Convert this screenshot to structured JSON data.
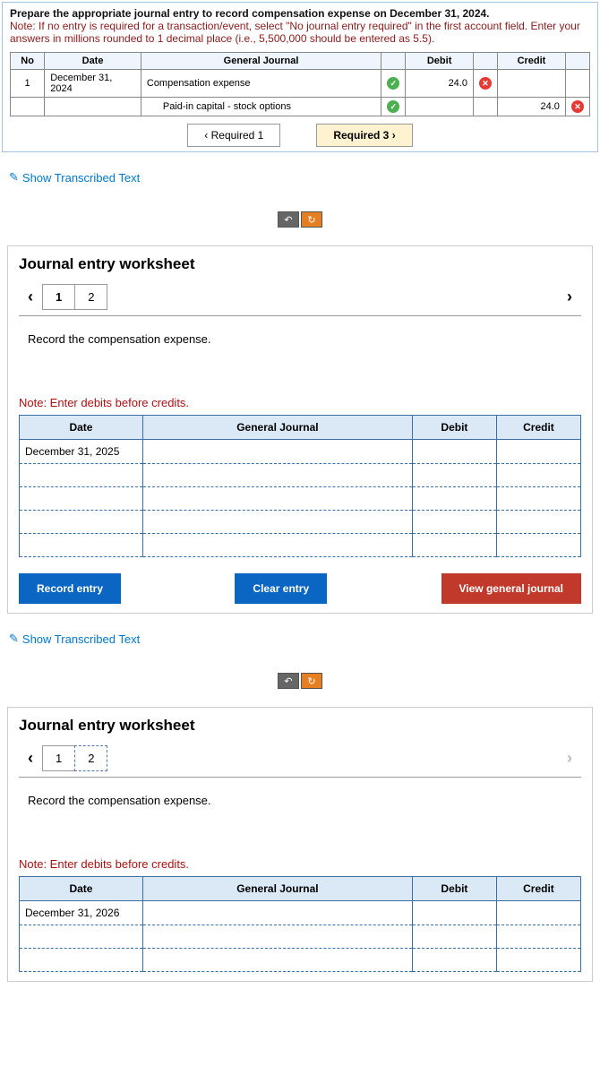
{
  "instruction": {
    "title": "Prepare the appropriate journal entry to record compensation expense on December 31, 2024.",
    "note": "Note: If no entry is required for a transaction/event, select \"No journal entry required\" in the first account field. Enter your answers in millions rounded to 1 decimal place (i.e., 5,500,000 should be entered as 5.5)."
  },
  "top_table": {
    "headers": {
      "no": "No",
      "date": "Date",
      "gj": "General Journal",
      "debit": "Debit",
      "credit": "Credit"
    },
    "rows": [
      {
        "no": "1",
        "date": "December 31, 2024",
        "account": "Compensation expense",
        "debit": "24.0",
        "debit_status": "x",
        "row_status": "check"
      },
      {
        "account": "Paid-in capital - stock options",
        "credit": "24.0",
        "credit_status": "x",
        "row_status": "check"
      }
    ]
  },
  "nav": {
    "prev": "‹  Required 1",
    "next": "Required 3  ›"
  },
  "show_transcribed": "Show Transcribed Text",
  "worksheet1": {
    "title": "Journal entry worksheet",
    "tabs": [
      "1",
      "2"
    ],
    "instruction": "Record the compensation expense.",
    "note": "Note: Enter debits before credits.",
    "headers": {
      "date": "Date",
      "gj": "General Journal",
      "debit": "Debit",
      "credit": "Credit"
    },
    "first_date": "December 31, 2025",
    "buttons": {
      "record": "Record entry",
      "clear": "Clear entry",
      "view": "View general journal"
    }
  },
  "worksheet2": {
    "title": "Journal entry worksheet",
    "tabs": [
      "1",
      "2"
    ],
    "instruction": "Record the compensation expense.",
    "note": "Note: Enter debits before credits.",
    "headers": {
      "date": "Date",
      "gj": "General Journal",
      "debit": "Debit",
      "credit": "Credit"
    },
    "first_date": "December 31, 2026"
  }
}
